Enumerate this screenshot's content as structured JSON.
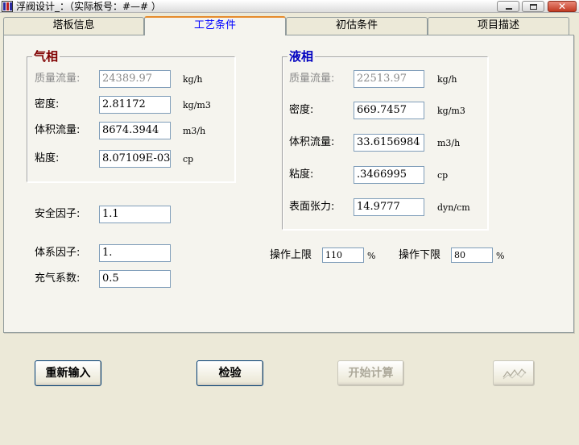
{
  "window": {
    "title": "浮阀设计_：（实际板号：#—# ）",
    "controls": {
      "minimize": "minimize-icon",
      "maximize": "maximize-icon",
      "close": "✕"
    }
  },
  "tabs": [
    {
      "label": "塔板信息",
      "active": false
    },
    {
      "label": "工艺条件",
      "active": true
    },
    {
      "label": "初估条件",
      "active": false
    },
    {
      "label": "项目描述",
      "active": false
    }
  ],
  "colors": {
    "vapor_title": "#800000",
    "liquid_title": "#0000c0",
    "active_tab": "#0000ff",
    "tab_highlight": "#e68b2c"
  },
  "vapor": {
    "title": "气相",
    "mass_flow": {
      "label": "质量流量:",
      "value": "24389.97",
      "unit": "kg/h"
    },
    "density": {
      "label": "密度:",
      "value": "2.81172",
      "unit": "kg/m3"
    },
    "volume_flow": {
      "label": "体积流量:",
      "value": "8674.3944",
      "unit": "m3/h"
    },
    "viscosity": {
      "label": "粘度:",
      "value": "8.07109E-03",
      "unit": "cp"
    }
  },
  "liquid": {
    "title": "液相",
    "mass_flow": {
      "label": "质量流量:",
      "value": "22513.97",
      "unit": "kg/h"
    },
    "density": {
      "label": "密度:",
      "value": "669.7457",
      "unit": "kg/m3"
    },
    "volume_flow": {
      "label": "体积流量:",
      "value": "33.6156984",
      "unit": "m3/h"
    },
    "viscosity": {
      "label": "粘度:",
      "value": ".3466995",
      "unit": "cp"
    },
    "surface_tension": {
      "label": "表面张力:",
      "value": "14.9777",
      "unit": "dyn/cm"
    }
  },
  "factors": {
    "safety": {
      "label": "安全因子:",
      "value": "1.1"
    },
    "system": {
      "label": "体系因子:",
      "value": "1."
    },
    "aeration": {
      "label": "充气系数:",
      "value": "0.5"
    }
  },
  "operating": {
    "upper": {
      "label": "操作上限",
      "value": "110",
      "unit": "%"
    },
    "lower": {
      "label": "操作下限",
      "value": "80",
      "unit": "%"
    }
  },
  "buttons": {
    "reset": "重新输入",
    "check": "检验",
    "start": "开始计算",
    "chart": "chart-icon"
  }
}
